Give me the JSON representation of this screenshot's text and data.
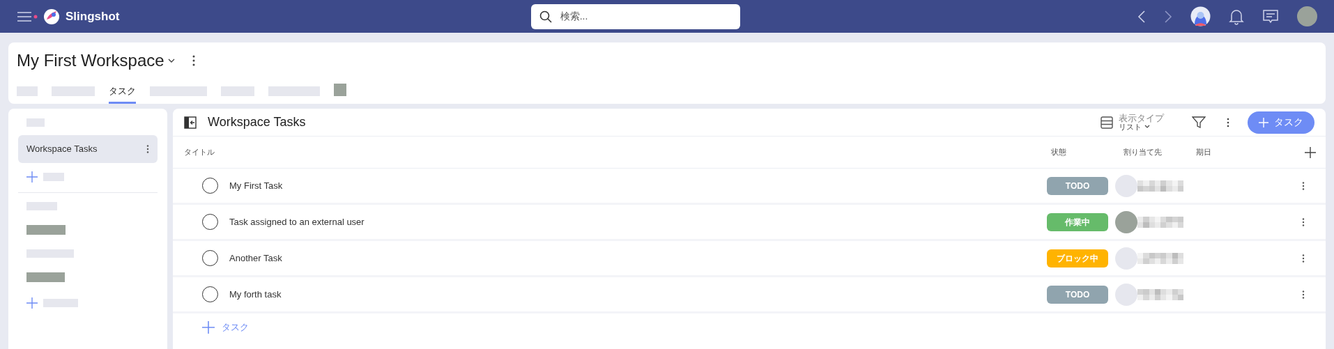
{
  "app": {
    "name": "Slingshot",
    "search": {
      "placeholder": "検索..."
    }
  },
  "workspace": {
    "title": "My First Workspace",
    "tabs": [
      {
        "kind": "redacted",
        "selected": false
      },
      {
        "kind": "redacted",
        "selected": false
      },
      {
        "kind": "text",
        "label": "タスク",
        "selected": true
      },
      {
        "kind": "redacted",
        "selected": false
      },
      {
        "kind": "redacted",
        "selected": false
      },
      {
        "kind": "redacted",
        "selected": false
      },
      {
        "kind": "masked",
        "selected": false
      }
    ]
  },
  "sidebar": {
    "items": [
      {
        "kind": "redacted"
      },
      {
        "kind": "text",
        "label": "Workspace Tasks",
        "selected": true
      },
      {
        "kind": "add"
      },
      {
        "kind": "divider"
      },
      {
        "kind": "redacted"
      },
      {
        "kind": "masked"
      },
      {
        "kind": "redacted"
      },
      {
        "kind": "masked"
      },
      {
        "kind": "add"
      }
    ]
  },
  "panel": {
    "title": "Workspace Tasks",
    "view_type": {
      "label": "表示タイプ",
      "value": "リスト"
    },
    "add_button": "タスク",
    "table": {
      "columns": [
        "タイトル",
        "状態",
        "割り当て先",
        "期日"
      ],
      "rows": [
        {
          "title": "My First Task",
          "done": false,
          "status": "TODO",
          "color": "#90a4ae",
          "avatar_filled": false
        },
        {
          "title": "Task assigned to an external user",
          "done": false,
          "status": "作業中",
          "color": "#66bb6a",
          "avatar_filled": true
        },
        {
          "title": "Another Task",
          "done": false,
          "status": "ブロック中",
          "color": "#ffb300",
          "avatar_filled": false
        },
        {
          "title": "My forth task",
          "done": false,
          "status": "TODO",
          "color": "#90a4ae",
          "avatar_filled": false
        }
      ]
    },
    "add_row": "タスク"
  }
}
